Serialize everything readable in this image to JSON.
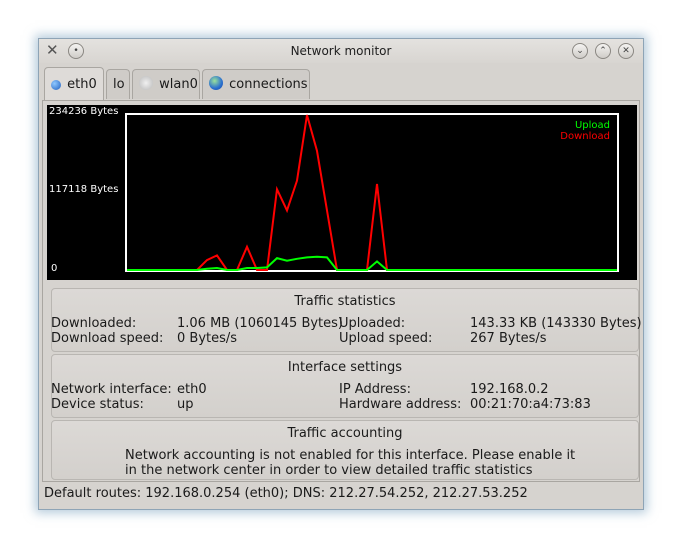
{
  "window": {
    "title": "Network monitor"
  },
  "tabs": [
    {
      "label": "eth0",
      "icon": "network-icon",
      "active": true
    },
    {
      "label": "lo",
      "active": false
    },
    {
      "label": "wlan0",
      "icon": "wireless-icon",
      "active": false
    },
    {
      "label": "connections",
      "icon": "globe-icon",
      "active": false
    }
  ],
  "chart_data": {
    "type": "line",
    "yticks": [
      "234236 Bytes",
      "117118 Bytes",
      "0"
    ],
    "ylim": [
      0,
      234236
    ],
    "legend": [
      "Upload",
      "Download"
    ],
    "legend_position": "top-right",
    "series": [
      {
        "name": "Download",
        "color": "#ff0000",
        "values": [
          0,
          0,
          0,
          0,
          0,
          0,
          0,
          0,
          15000,
          22000,
          0,
          0,
          35000,
          0,
          0,
          122000,
          90000,
          135000,
          234236,
          180000,
          90000,
          0,
          0,
          0,
          0,
          130000,
          0,
          0,
          0,
          0,
          0,
          0,
          0,
          0,
          0,
          0,
          0,
          0,
          0,
          0,
          0,
          0,
          0,
          0,
          0,
          0,
          0,
          0,
          0,
          0
        ]
      },
      {
        "name": "Upload",
        "color": "#00ff00",
        "values": [
          0,
          0,
          0,
          0,
          0,
          0,
          0,
          0,
          2000,
          3000,
          0,
          0,
          3000,
          3000,
          4000,
          18000,
          14000,
          17000,
          19000,
          20000,
          19000,
          0,
          0,
          0,
          0,
          13000,
          0,
          0,
          0,
          0,
          0,
          0,
          0,
          0,
          0,
          0,
          0,
          0,
          0,
          0,
          0,
          0,
          0,
          0,
          0,
          0,
          0,
          0,
          0,
          0
        ]
      }
    ]
  },
  "traffic": {
    "title": "Traffic statistics",
    "downloaded_label": "Downloaded:",
    "downloaded_value": "1.06 MB (1060145 Bytes)",
    "uploaded_label": "Uploaded:",
    "uploaded_value": "143.33 KB (143330 Bytes)",
    "download_speed_label": "Download speed:",
    "download_speed_value": "0 Bytes/s",
    "upload_speed_label": "Upload speed:",
    "upload_speed_value": "267 Bytes/s"
  },
  "interface": {
    "title": "Interface settings",
    "network_interface_label": "Network interface:",
    "network_interface_value": "eth0",
    "ip_label": "IP Address:",
    "ip_value": "192.168.0.2",
    "device_status_label": "Device status:",
    "device_status_value": "up",
    "hw_label": "Hardware address:",
    "hw_value": "00:21:70:a4:73:83"
  },
  "accounting": {
    "title": "Traffic accounting",
    "line1": "Network accounting is not enabled for this interface. Please enable it",
    "line2": "in the network center in order to view detailed traffic statistics"
  },
  "status": {
    "routes": "Default routes: 192.168.0.254 (eth0); DNS: 212.27.54.252, 212.27.53.252"
  }
}
